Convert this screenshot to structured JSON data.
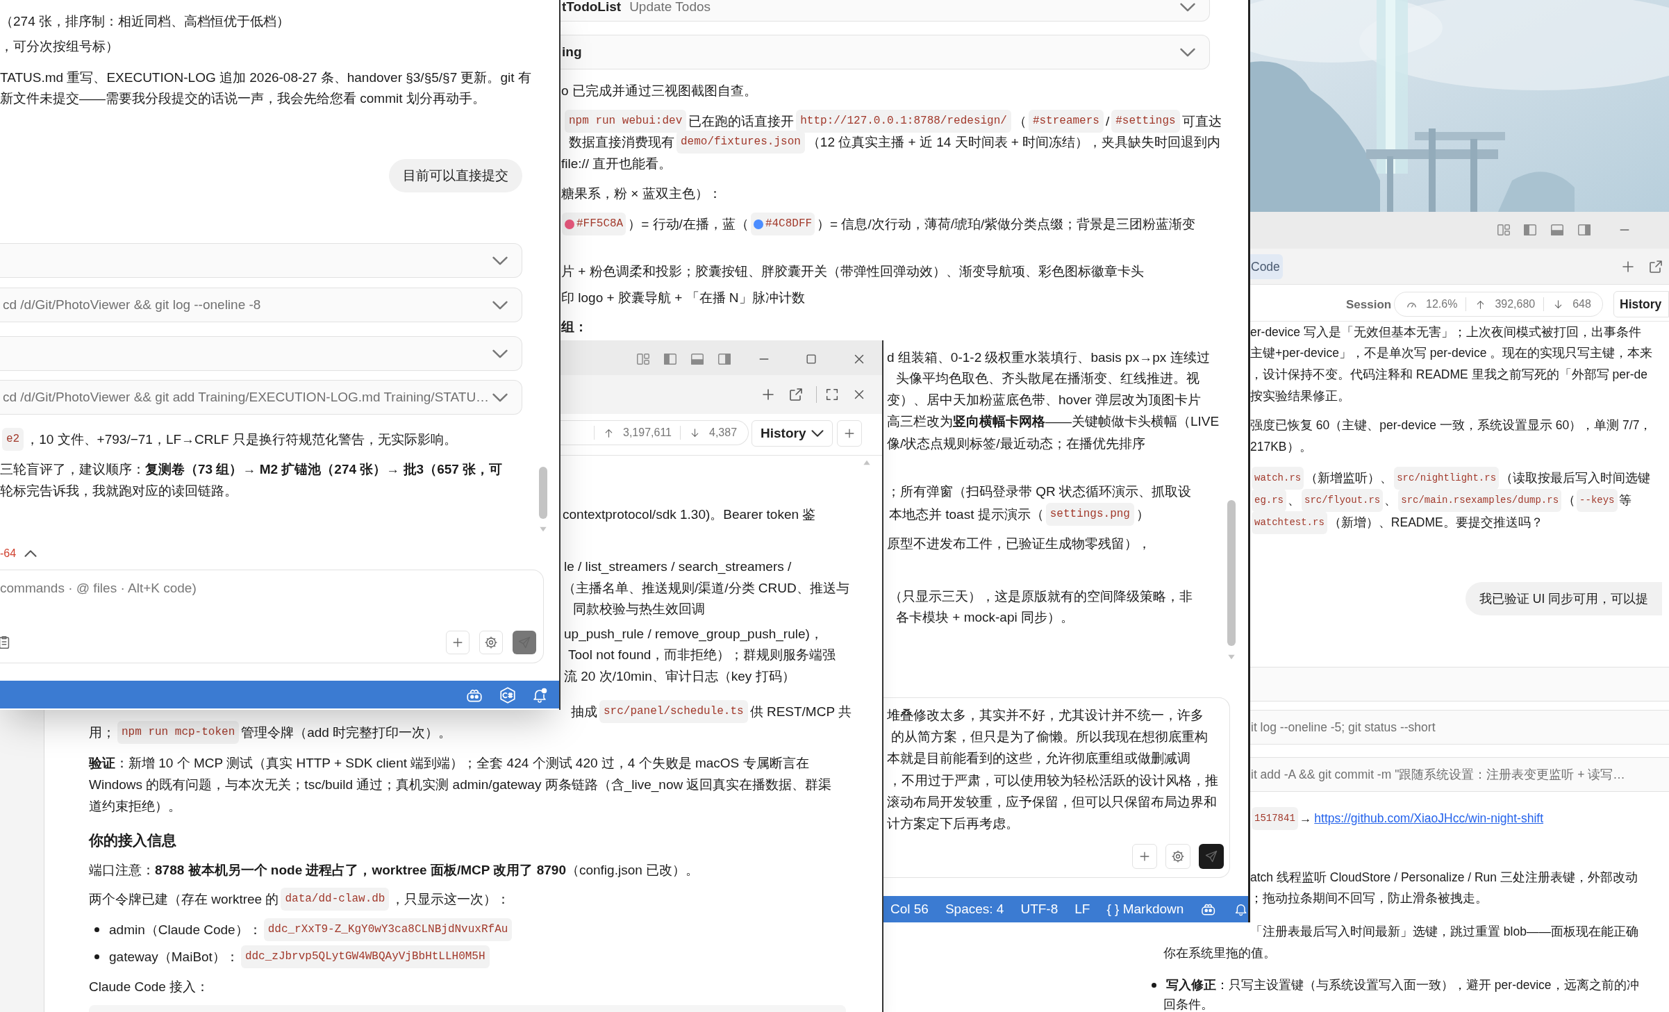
{
  "left_chat": {
    "blocks": [
      {
        "kind": "text",
        "parts": [
          {
            "kind": "text",
            "text": "（274 张，排序制：相近同档、高档恒优于低档）"
          }
        ]
      },
      {
        "kind": "text",
        "parts": [
          {
            "kind": "text",
            "text": "，可分次按组号标）"
          }
        ]
      },
      {
        "kind": "text",
        "parts": [
          {
            "kind": "text",
            "text": "TATUS.md 重写、EXECUTION-LOG 追加 2026-08-27 条、handover §3/§5/§7 更新。git 有"
          }
        ]
      },
      {
        "kind": "text",
        "parts": [
          {
            "kind": "text",
            "text": "新文件未提交——需要我分段提交的话说一声，我会先给您看 commit 划分再动手。"
          }
        ]
      },
      {
        "kind": "bubble",
        "text": "目前可以直接提交"
      },
      {
        "kind": "tool_row"
      },
      {
        "kind": "tool_row",
        "detail": "cd /d/Git/PhotoViewer && git log --oneline -8"
      },
      {
        "kind": "tool_row"
      },
      {
        "kind": "tool_row",
        "detail": "cd /d/Git/PhotoViewer && git add Training/EXECUTION-LOG.md Training/STATU…"
      },
      {
        "kind": "text",
        "parts": [
          {
            "kind": "code",
            "text": "e2"
          },
          {
            "kind": "text",
            "text": "，10 文件、+793/−71，LF→CRLF 只是换行符规范化警告，无实际影响。"
          }
        ]
      },
      {
        "kind": "text",
        "parts": [
          {
            "kind": "text",
            "text": "三轮盲评了，建议顺序：**复测卷（73 组）→ M2 扩锚池（274 张）→ 批3（657 张，可**"
          }
        ]
      },
      {
        "kind": "text",
        "parts": [
          {
            "kind": "text",
            "text": "轮标完告诉我，我就跑对应的读回链路。"
          }
        ]
      },
      {
        "kind": "diff",
        "text": "-64"
      }
    ],
    "composer": {
      "placeholder": "commands · @ files · Alt+K code)"
    }
  },
  "middle_chat": {
    "blocks": [
      {
        "kind": "tool_row",
        "title": "tTodoList",
        "detail": "Update Todos"
      },
      {
        "kind": "tool_row",
        "title": "ing"
      },
      {
        "kind": "text",
        "parts": [
          {
            "kind": "text",
            "text": "o 已完成并通过三视图截图自查。"
          }
        ]
      },
      {
        "kind": "text",
        "parts": [
          {
            "kind": "code",
            "text": "npm run webui:dev"
          },
          {
            "kind": "text",
            "text": " 已在跑的话直接开 "
          },
          {
            "kind": "code",
            "text": "http://127.0.0.1:8788/redesign/"
          },
          {
            "kind": "text",
            "text": "（"
          },
          {
            "kind": "code",
            "text": "#streamers"
          },
          {
            "kind": "text",
            "text": " / "
          },
          {
            "kind": "code",
            "text": "#settings"
          },
          {
            "kind": "text",
            "text": " 可直达"
          }
        ]
      },
      {
        "kind": "text",
        "parts": [
          {
            "kind": "text",
            "text": "数据直接消费现有 "
          },
          {
            "kind": "code",
            "text": "demo/fixtures.json"
          },
          {
            "kind": "text",
            "text": "（12 位真实主播 + 近 14 天时间表 + 时间冻结），夹具缺失时回退到内"
          }
        ]
      },
      {
        "kind": "text",
        "parts": [
          {
            "kind": "text",
            "text": "file:// 直开也能看。"
          }
        ]
      },
      {
        "kind": "text",
        "parts": [
          {
            "kind": "text",
            "text": "糖果系，粉 × 蓝双主色）："
          }
        ]
      },
      {
        "kind": "text",
        "parts": [
          {
            "kind": "swatch",
            "text": "#FF5C8A",
            "color": "#e8587d"
          },
          {
            "kind": "text",
            "text": "）= 行动/在播，蓝（"
          },
          {
            "kind": "swatch",
            "text": "#4C8DFF",
            "color": "#4c8dff"
          },
          {
            "kind": "text",
            "text": "）= 信息/次行动，薄荷/琥珀/紫做分类点缀；背景是三团粉蓝渐变"
          }
        ]
      },
      {
        "kind": "text",
        "parts": [
          {
            "kind": "text",
            "text": "片 + 粉色调柔和投影；胶囊按钮、胖胶囊开关（带弹性回弹动效）、渐变导航项、彩色图标徽章卡头"
          }
        ]
      },
      {
        "kind": "text",
        "parts": [
          {
            "kind": "text",
            "text": "印 logo + 胶囊导航 + 「在播 N」脉冲计数"
          }
        ]
      },
      {
        "kind": "subheading",
        "text": "组："
      },
      {
        "kind": "text",
        "parts": [
          {
            "kind": "text",
            "text": "d 组装箱、0-1-2 级权重水装填行、basis px→px 连续过"
          }
        ]
      },
      {
        "kind": "text",
        "parts": [
          {
            "kind": "text",
            "text": "头像平均色取色、齐头散尾在播渐变、红线推进。视"
          }
        ]
      },
      {
        "kind": "text",
        "parts": [
          {
            "kind": "text",
            "text": "变）、居中天加粉蓝底色带、hover 弹层改为顶图卡片"
          }
        ]
      },
      {
        "kind": "text",
        "parts": [
          {
            "kind": "text",
            "text": "高三栏改为**竖向横幅卡网格**——关键帧做卡头横幅（LIVE"
          }
        ]
      },
      {
        "kind": "text",
        "parts": [
          {
            "kind": "text",
            "text": "像/状态点规则标签/最近动态；在播优先排序"
          }
        ]
      },
      {
        "kind": "text",
        "parts": [
          {
            "kind": "text",
            "text": "；所有弹窗（扫码登录带 QR 状态循环演示、抓取设"
          }
        ]
      },
      {
        "kind": "text",
        "parts": [
          {
            "kind": "text",
            "text": "本地态并 toast 提示演示（"
          },
          {
            "kind": "code",
            "text": "settings.png"
          },
          {
            "kind": "text",
            "text": "）"
          }
        ]
      },
      {
        "kind": "text",
        "parts": [
          {
            "kind": "text",
            "text": "原型不进发布工件，已验证生成物零残留），"
          }
        ]
      },
      {
        "kind": "text",
        "parts": [
          {
            "kind": "text",
            "text": "（只显示三天），这是原版就有的空间降级策略，非"
          }
        ]
      },
      {
        "kind": "text",
        "parts": [
          {
            "kind": "text",
            "text": "各卡模块 + mock-api 同步）。"
          }
        ]
      }
    ],
    "composer": {
      "lines": [
        "堆叠修改太多，其实并不好，尤其设计并不统一，许多",
        "的从简方案，但只是为了偷懒。所以我现在想彻底重构",
        "本就是目前能看到的这些，允许彻底重组或做删减调",
        "，不用过于严肃，可以使用较为轻松活跃的设计风格，推",
        "滚动布局开发较重，应予保留，但可以只保留布局边界和",
        "计方案定下后再考虑。"
      ]
    },
    "status_bar": [
      "Col 56",
      "Spaces: 4",
      "UTF-8",
      "LF",
      "{ } Markdown"
    ]
  },
  "popup_chat": {
    "stats": {
      "tokens_up": "3,197,611",
      "tokens_down": "4,387"
    },
    "history_button": "History",
    "blocks": [
      {
        "kind": "text",
        "parts": [
          {
            "kind": "text",
            "text": "contextprotocol/sdk 1.30)。Bearer token 鉴"
          }
        ]
      },
      {
        "kind": "text",
        "parts": [
          {
            "kind": "text",
            "text": "le / list_streamers / search_streamers /"
          }
        ]
      },
      {
        "kind": "text",
        "parts": [
          {
            "kind": "text",
            "text": "（主播名单、推送规则/渠道/分类 CRUD、推送与"
          }
        ]
      },
      {
        "kind": "text",
        "parts": [
          {
            "kind": "text",
            "text": "同款校验与热生效回调"
          }
        ]
      },
      {
        "kind": "text",
        "parts": [
          {
            "kind": "text",
            "text": "up_push_rule / remove_group_push_rule)，"
          }
        ]
      },
      {
        "kind": "text",
        "parts": [
          {
            "kind": "text",
            "text": "Tool not found，而非拒绝）；群规则服务端强"
          }
        ]
      },
      {
        "kind": "text",
        "parts": [
          {
            "kind": "text",
            "text": "流 20 次/10min、审计日志（key 打码）"
          }
        ]
      },
      {
        "kind": "text",
        "parts": [
          {
            "kind": "text",
            "text": "抽成 "
          },
          {
            "kind": "code",
            "text": "src/panel/schedule.ts"
          },
          {
            "kind": "text",
            "text": " 供 REST/MCP 共"
          }
        ]
      },
      {
        "kind": "text",
        "parts": [
          {
            "kind": "text",
            "text": "用；"
          },
          {
            "kind": "code",
            "text": "npm run mcp-token"
          },
          {
            "kind": "text",
            "text": " 管理令牌（add 时完整打印一次）。"
          }
        ]
      },
      {
        "kind": "text",
        "parts": [
          {
            "kind": "text",
            "text": "**验证**：新增 10 个 MCP 测试（真实 HTTP + SDK client 端到端）；全套 424 个测试 420 过，4 个失败是 macOS 专属断言在"
          }
        ]
      },
      {
        "kind": "text",
        "parts": [
          {
            "kind": "text",
            "text": "Windows 的既有问题，与本次无关；tsc/build 通过；真机实测 admin/gateway 两条链路（含_live_now 返回真实在播数据、群渠"
          }
        ]
      },
      {
        "kind": "text",
        "parts": [
          {
            "kind": "text",
            "text": "道约束拒绝）。"
          }
        ]
      },
      {
        "kind": "heading",
        "text": "你的接入信息"
      },
      {
        "kind": "text",
        "parts": [
          {
            "kind": "text",
            "text": "端口注意：**8788 被本机另一个 node 进程占了，worktree 面板/MCP 改用了 8790**（config.json 已改）。"
          }
        ]
      },
      {
        "kind": "text",
        "parts": [
          {
            "kind": "text",
            "text": "两个令牌已建（存在 worktree 的 "
          },
          {
            "kind": "code",
            "text": "data/dd-claw.db"
          },
          {
            "kind": "text",
            "text": "，只显示这一次）："
          }
        ]
      },
      {
        "kind": "bullet",
        "parts": [
          {
            "kind": "text",
            "text": "admin（Claude Code）："
          },
          {
            "kind": "code",
            "text": "ddc_rXxT9-Z_KgY0wY3ca8CLNBjdNvuxRfAu"
          }
        ]
      },
      {
        "kind": "bullet",
        "parts": [
          {
            "kind": "text",
            "text": "gateway（MaiBot）："
          },
          {
            "kind": "code",
            "text": "ddc_zJbrvp5QLytGW4WBQAyVjBbHtLLH0M5H"
          }
        ]
      },
      {
        "kind": "text",
        "parts": [
          {
            "kind": "text",
            "text": "Claude Code 接入："
          }
        ]
      }
    ]
  },
  "right_chat": {
    "tab": "Code",
    "session_label": "Session",
    "stats": {
      "context": "12.6%",
      "tokens_up": "392,680",
      "tokens_down": "648"
    },
    "history_button": "History",
    "blocks": [
      {
        "kind": "text",
        "parts": [
          {
            "kind": "text",
            "text": "er-device 写入是「无效但基本无害」；上次夜间模式被打回，出事条件"
          }
        ]
      },
      {
        "kind": "text",
        "parts": [
          {
            "kind": "text",
            "text": "主键+per-device」，不是单次写 per-device 。现在的实现只写主键，本来"
          }
        ]
      },
      {
        "kind": "text",
        "parts": [
          {
            "kind": "text",
            "text": "，设计保持不变。代码注释和 README 里我之前写死的「外部写 per-de"
          }
        ]
      },
      {
        "kind": "text",
        "parts": [
          {
            "kind": "text",
            "text": "按实验结果修正。"
          }
        ]
      },
      {
        "kind": "text",
        "parts": [
          {
            "kind": "text",
            "text": "强度已恢复 60（主键、per-device 一致，系统设置显示 60），单测 7/7，"
          }
        ]
      },
      {
        "kind": "text",
        "parts": [
          {
            "kind": "text",
            "text": "217KB）。"
          }
        ]
      },
      {
        "kind": "text",
        "parts": [
          {
            "kind": "code",
            "text": "watch.rs"
          },
          {
            "kind": "text",
            "text": "（新增监听）、"
          },
          {
            "kind": "code",
            "text": "src/nightlight.rs"
          },
          {
            "kind": "text",
            "text": "（读取按最后写入时间选键"
          }
        ]
      },
      {
        "kind": "text",
        "parts": [
          {
            "kind": "code",
            "text": "eg.rs"
          },
          {
            "kind": "text",
            "text": "、"
          },
          {
            "kind": "code",
            "text": "src/flyout.rs"
          },
          {
            "kind": "text",
            "text": "、"
          },
          {
            "kind": "code",
            "text": "src/main.rsexamples/dump.rs"
          },
          {
            "kind": "text",
            "text": "（"
          },
          {
            "kind": "code",
            "text": "--keys"
          },
          {
            "kind": "text",
            "text": " 等"
          }
        ]
      },
      {
        "kind": "text",
        "parts": [
          {
            "kind": "code",
            "text": "watchtest.rs"
          },
          {
            "kind": "text",
            "text": "（新增）、README。要提交推送吗？"
          }
        ]
      },
      {
        "kind": "bubble",
        "text": "我已验证 UI 同步可用，可以提"
      },
      {
        "kind": "tool_row"
      },
      {
        "kind": "tool_row",
        "detail": "it log --oneline -5; git status --short"
      },
      {
        "kind": "tool_row",
        "detail": "it add -A && git commit -m \"跟随系统设置：注册表变更监听 + 读写…"
      },
      {
        "kind": "text",
        "parts": [
          {
            "kind": "code",
            "text": "1517841"
          },
          {
            "kind": "text",
            "text": "→"
          },
          {
            "kind": "link",
            "text": "https://github.com/XiaoJHcc/win-night-shift"
          }
        ]
      },
      {
        "kind": "text",
        "parts": [
          {
            "kind": "text",
            "text": "atch 线程监听 CloudStore / Personalize / Run 三处注册表键，外部改动"
          }
        ]
      },
      {
        "kind": "text",
        "parts": [
          {
            "kind": "text",
            "text": "；拖动拉条期间不回写，防止滑条被拽走。"
          }
        ]
      },
      {
        "kind": "text",
        "parts": [
          {
            "kind": "text",
            "text": "「注册表最后写入时间最新」选键，跳过重置 blob——面板现在能正确"
          }
        ]
      },
      {
        "kind": "text",
        "parts": [
          {
            "kind": "text",
            "text": "你在系统里拖的值。"
          }
        ]
      },
      {
        "kind": "bullet",
        "parts": [
          {
            "kind": "text",
            "text": "**写入修正**：只写主设置键（与系统设置写入面一致），避开 per-device，远离之前的冲"
          }
        ]
      },
      {
        "kind": "text",
        "parts": [
          {
            "kind": "text",
            "text": "回条件。"
          }
        ]
      }
    ]
  }
}
